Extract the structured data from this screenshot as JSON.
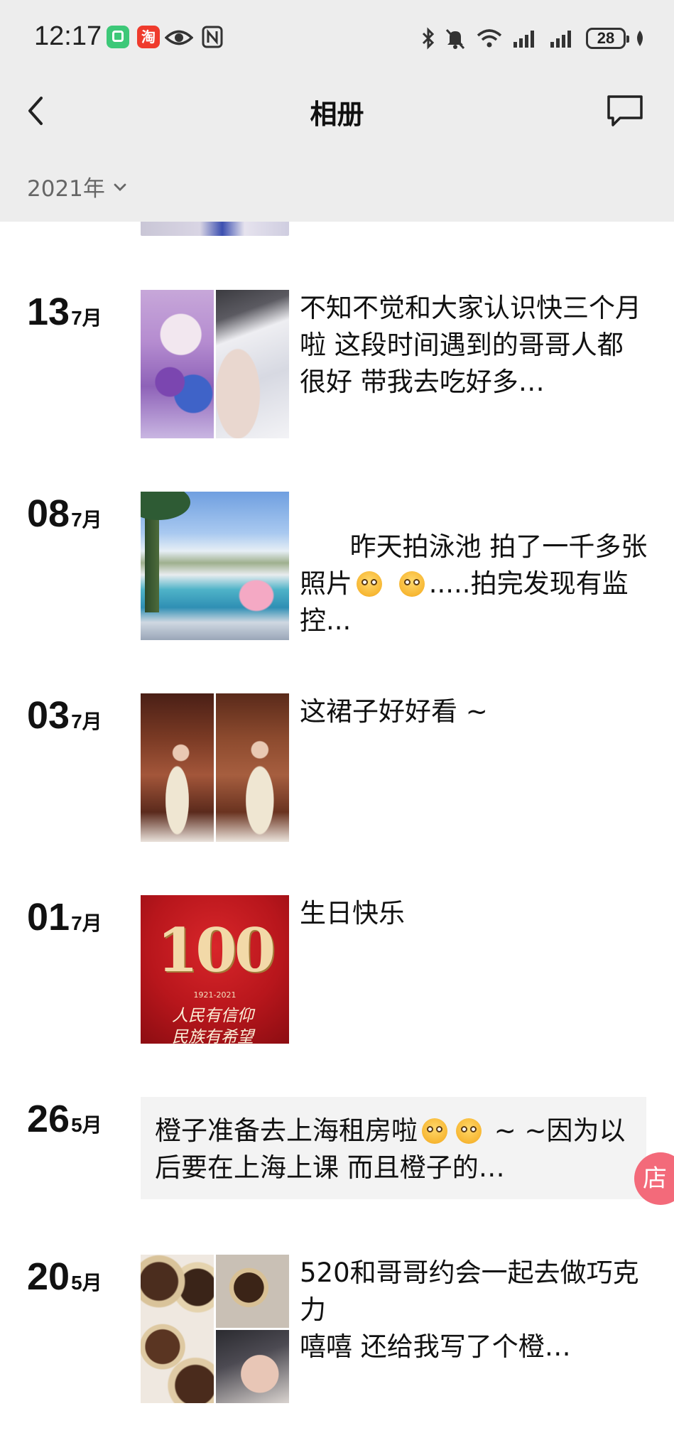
{
  "status_bar": {
    "time": "12:17",
    "app2_icon_text": "淘",
    "battery": "28",
    "icons": [
      "app-icon",
      "taobao-icon",
      "eye-icon",
      "nfc-icon",
      "bluetooth-icon",
      "mute-icon",
      "wifi-icon",
      "signal-icon",
      "signal-icon",
      "battery-icon",
      "leaf-icon"
    ]
  },
  "header": {
    "title": "相册",
    "back_icon": "chevron-left-icon",
    "message_icon": "message-icon"
  },
  "year_filter": {
    "label": "2021年",
    "icon": "chevron-down-icon"
  },
  "entries": [
    {
      "day": "13",
      "month": "7月",
      "caption": "不知不觉和大家认识快三个月啦 这段时间遇到的哥哥人都很好 带我去吃好多…"
    },
    {
      "day": "08",
      "month": "7月",
      "caption_a": "昨天拍泳池 拍了一千多张照片",
      "caption_b": ".....拍完发现有监控..."
    },
    {
      "day": "03",
      "month": "7月",
      "caption": "这裙子好好看 ~"
    },
    {
      "day": "01",
      "month": "7月",
      "caption": "生日快乐",
      "poster_number": "100",
      "poster_years": "1921-2021",
      "poster_line1": "人民有信仰",
      "poster_line2": "民族有希望"
    },
    {
      "day": "26",
      "month": "5月",
      "text_a": "橙子准备去上海租房啦",
      "text_b": " ~ ~因为以后要在上海上课 而且橙子的…"
    },
    {
      "day": "20",
      "month": "5月",
      "caption": "520和哥哥约会一起去做巧克力\n嘻嘻 还给我写了个橙…"
    }
  ],
  "floating_badge": "店",
  "colors": {
    "header_bg": "#ededed",
    "card_bg": "#f3f3f3",
    "badge": "#f36a7a"
  }
}
